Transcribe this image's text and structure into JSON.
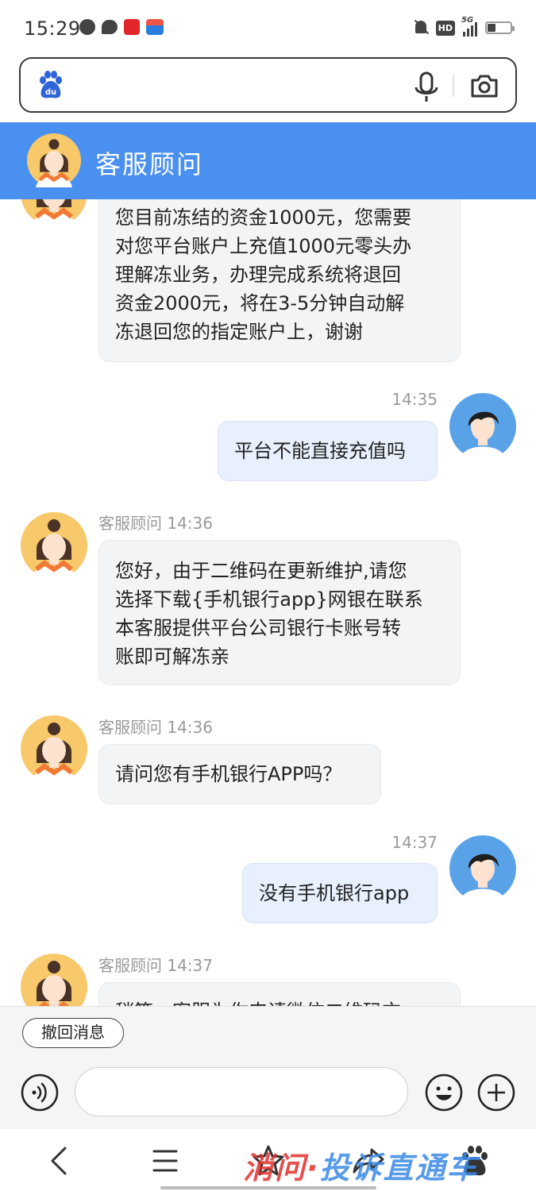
{
  "status_bar": {
    "time": "15:29",
    "network": "5G",
    "hd_badge": "HD"
  },
  "search": {
    "logo_text": "du",
    "placeholder": ""
  },
  "header": {
    "title": "客服顾问"
  },
  "messages": [
    {
      "direction": "in",
      "meta": "",
      "text": "您目前冻结的资金1000元，您需要\n对您平台账户上充值1000元零头办\n理解冻业务，办理完成系统将退回\n资金2000元，将在3-5分钟自动解\n冻退回您的指定账户上，谢谢"
    },
    {
      "direction": "out",
      "meta": "14:35",
      "text": "平台不能直接充值吗"
    },
    {
      "direction": "in",
      "meta": "客服顾问 14:36",
      "text": "您好，由于二维码在更新维护,请您\n选择下载{手机银行app}网银在联系\n本客服提供平台公司银行卡账号转\n账即可解冻亲"
    },
    {
      "direction": "in",
      "meta": "客服顾问 14:36",
      "text": "请问您有手机银行APP吗？"
    },
    {
      "direction": "out",
      "meta": "14:37",
      "text": "没有手机银行app"
    },
    {
      "direction": "in",
      "meta": "客服顾问 14:37",
      "text": "稍等，客服为你申请微信二维码充"
    }
  ],
  "input": {
    "recall_label": "撤回消息",
    "placeholder": ""
  },
  "bottom_nav": {
    "items": [
      "back",
      "menu",
      "favorite",
      "share",
      "baidu-home"
    ]
  },
  "watermark": {
    "part1": "消问·",
    "part2": "投诉直通车"
  },
  "colors": {
    "header_blue": "#4a90f0",
    "incoming_bubble": "#f3f4f6",
    "outgoing_bubble": "#e8f0fd",
    "meta_gray": "#9a9a9a"
  }
}
